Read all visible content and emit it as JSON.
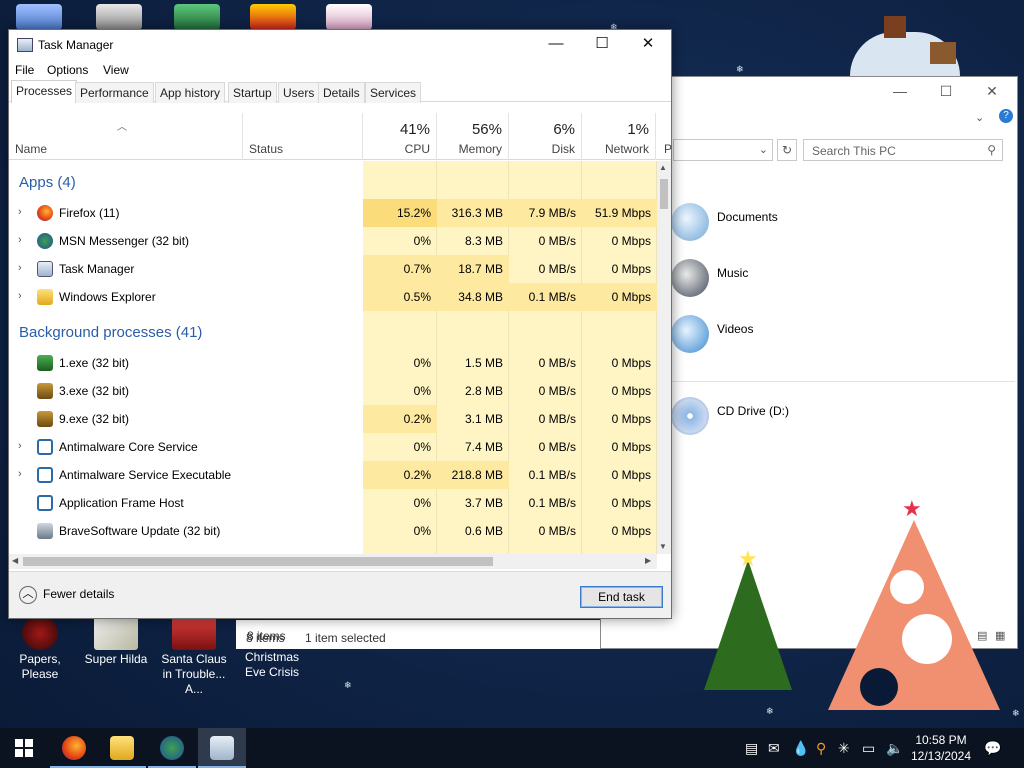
{
  "desktop": {
    "icons": [
      {
        "label": "Papers, Please"
      },
      {
        "label": "Super Hilda"
      },
      {
        "label": "Santa Claus in Trouble... A..."
      },
      {
        "label": "Christmas Eve Crisis"
      }
    ]
  },
  "explorer": {
    "search_placeholder": "Search This PC",
    "items": [
      {
        "label": "Documents",
        "icon": "documents-icon"
      },
      {
        "label": "Music",
        "icon": "music-icon"
      },
      {
        "label": "Videos",
        "icon": "videos-icon"
      },
      {
        "label": "CD Drive (D:)",
        "icon": "cd-drive-icon"
      }
    ],
    "status_items": "8 items",
    "status_selected": "1 item selected"
  },
  "taskmgr": {
    "title": "Task Manager",
    "menu": [
      "File",
      "Options",
      "View"
    ],
    "tabs": [
      "Processes",
      "Performance",
      "App history",
      "Startup",
      "Users",
      "Details",
      "Services"
    ],
    "active_tab": "Processes",
    "columns": {
      "name": "Name",
      "status": "Status",
      "cpu": {
        "pct": "41%",
        "label": "CPU"
      },
      "memory": {
        "pct": "56%",
        "label": "Memory"
      },
      "disk": {
        "pct": "6%",
        "label": "Disk"
      },
      "network": {
        "pct": "1%",
        "label": "Network"
      },
      "overflow": "P"
    },
    "groups": {
      "apps": "Apps (4)",
      "background": "Background processes (41)"
    },
    "apps": [
      {
        "name": "Firefox (11)",
        "cpu": "15.2%",
        "memory": "316.3 MB",
        "disk": "7.9 MB/s",
        "network": "51.9 Mbps"
      },
      {
        "name": "MSN Messenger (32 bit)",
        "cpu": "0%",
        "memory": "8.3 MB",
        "disk": "0 MB/s",
        "network": "0 Mbps"
      },
      {
        "name": "Task Manager",
        "cpu": "0.7%",
        "memory": "18.7 MB",
        "disk": "0 MB/s",
        "network": "0 Mbps"
      },
      {
        "name": "Windows Explorer",
        "cpu": "0.5%",
        "memory": "34.8 MB",
        "disk": "0.1 MB/s",
        "network": "0 Mbps"
      }
    ],
    "background": [
      {
        "name": "1.exe (32 bit)",
        "cpu": "0%",
        "memory": "1.5 MB",
        "disk": "0 MB/s",
        "network": "0 Mbps"
      },
      {
        "name": "3.exe (32 bit)",
        "cpu": "0%",
        "memory": "2.8 MB",
        "disk": "0 MB/s",
        "network": "0 Mbps"
      },
      {
        "name": "9.exe (32 bit)",
        "cpu": "0.2%",
        "memory": "3.1 MB",
        "disk": "0 MB/s",
        "network": "0 Mbps"
      },
      {
        "name": "Antimalware Core Service",
        "cpu": "0%",
        "memory": "7.4 MB",
        "disk": "0 MB/s",
        "network": "0 Mbps"
      },
      {
        "name": "Antimalware Service Executable",
        "cpu": "0.2%",
        "memory": "218.8 MB",
        "disk": "0.1 MB/s",
        "network": "0 Mbps"
      },
      {
        "name": "Application Frame Host",
        "cpu": "0%",
        "memory": "3.7 MB",
        "disk": "0.1 MB/s",
        "network": "0 Mbps"
      },
      {
        "name": "BraveSoftware Update (32 bit)",
        "cpu": "0%",
        "memory": "0.6 MB",
        "disk": "0 MB/s",
        "network": "0 Mbps"
      }
    ],
    "fewer_details": "Fewer details",
    "end_task": "End task"
  },
  "taskbar": {
    "time": "10:58 PM",
    "date": "12/13/2024",
    "apps": [
      "start-icon",
      "firefox-icon",
      "file-explorer-icon",
      "msn-messenger-icon",
      "task-manager-icon"
    ]
  }
}
